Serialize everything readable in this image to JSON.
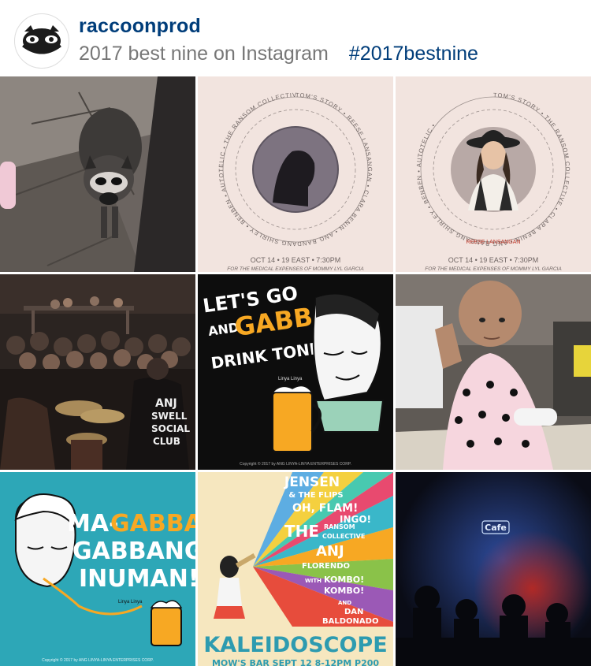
{
  "header": {
    "username": "raccoonprod",
    "caption": "2017 best nine on Instagram",
    "hashtag": "#2017bestnine",
    "avatar_icon": "raccoon-logo-icon"
  },
  "posts": [
    {
      "id": "raccoon-photo"
    },
    {
      "id": "poster-silhouette",
      "ring_text": "TOM'S STORY • REESE LANSANGAN • CLARA BENIN • ANG BANDANG SHIRLEY • BENBEN • AUTOTELIC • THE RANSOM COLLECTIVE • I BELONG TO THE ZOO •",
      "date_line": "OCT 14 • 19 EAST • 7:30PM",
      "sub_line": "FOR THE MEDICAL EXPENSES OF MOMMY LYL GARCIA"
    },
    {
      "id": "poster-reese",
      "ring_text": "TOM'S STORY • THE RANSOM COLLECTIVE • CLARA BENIN • ANG BANDANG SHIRLEY • BENBEN • AUTOTELIC •",
      "ring_highlight": "REESE LANSANGAN",
      "ring_tail": "I BELONG TO THE ZOO •",
      "date_line": "OCT 14 • 19 EAST • 7:30PM",
      "sub_line": "FOR THE MEDICAL EXPENSES OF MOMMY LYL GARCIA"
    },
    {
      "id": "concert-photo",
      "shirt_lines": [
        "ANJ",
        "SWELL",
        "SOCIAL",
        "CLUB"
      ]
    },
    {
      "id": "gabba-drink",
      "lines": [
        "LET'S GO",
        "AND",
        "GABBA",
        "DRINK TONIGHT!"
      ],
      "copyright": "Copyright © 2017 by ANG LINYA-LINYA ENTERPRISES CORP.",
      "brand": "Linya Linya"
    },
    {
      "id": "child-photo"
    },
    {
      "id": "ma-gabba",
      "lines": [
        "MA-",
        "GABBA",
        "GABBANG",
        "INUMAN!"
      ],
      "copyright": "Copyright © 2017 by ANG LINYA-LINYA ENTERPRISES CORP.",
      "brand": "Linya Linya"
    },
    {
      "id": "kaleidoscope",
      "acts": [
        "JENSEN",
        "& THE FLIPS",
        "OH, FLAM!",
        "INGO!",
        "THE",
        "RANSOM",
        "COLLECTIVE",
        "ANJ",
        "FLORENDO",
        "WITH",
        "KOMBO!",
        "KOMBO!",
        "AND",
        "DAN",
        "BALDONADO"
      ],
      "title": "KALEIDOSCOPE",
      "footer": "MOW'S BAR SEPT 12 8-12PM P200"
    },
    {
      "id": "cafe-photo",
      "sign": "Cafe"
    }
  ],
  "colors": {
    "username": "#003d7a",
    "caption": "#777777",
    "poster_bg": "#f2e4df",
    "teal_bg": "#2da7b7",
    "orange": "#f7a823",
    "cream": "#f6e7bf",
    "accent_red": "#c0392b"
  }
}
